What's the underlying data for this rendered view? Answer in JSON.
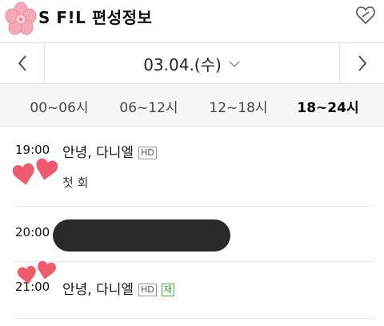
{
  "header": {
    "title": "S F!L 편성정보"
  },
  "datebar": {
    "date": "03.04.(수)"
  },
  "tabs": [
    {
      "label": "00~06시"
    },
    {
      "label": "06~12시"
    },
    {
      "label": "12~18시"
    },
    {
      "label": "18~24시",
      "active": true
    }
  ],
  "schedule": [
    {
      "time": "19:00",
      "title": "안녕, 다니엘",
      "badges": [
        "HD"
      ],
      "subtitle": "첫 회"
    },
    {
      "time": "20:00",
      "title": "",
      "badges": [],
      "subtitle": ""
    },
    {
      "time": "21:00",
      "title": "안녕, 다니엘",
      "badges": [
        "HD",
        "재"
      ],
      "subtitle": ""
    }
  ],
  "colors": {
    "heart": "#ef5b6e",
    "flower": "#f6a9b6",
    "rerun_badge": "#2e9b34",
    "redaction": "#2a2a2a"
  },
  "icons": [
    "flower-sticker-icon",
    "favorite-heart-icon",
    "chevron-left-icon",
    "chevron-down-icon",
    "chevron-right-icon",
    "heart-sticker-icon"
  ]
}
